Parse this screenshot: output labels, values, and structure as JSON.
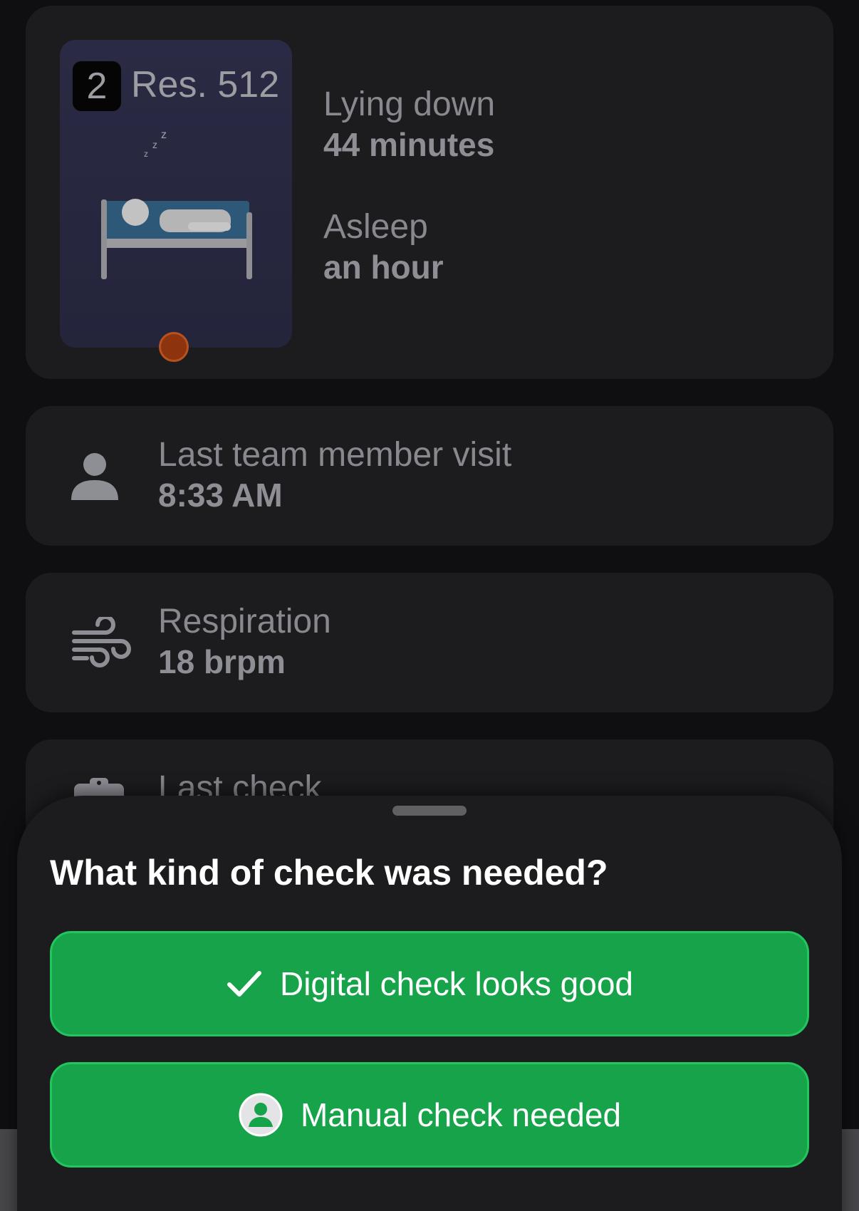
{
  "resident_card": {
    "room_number": "2",
    "room_label": "Res. 512",
    "bed_icon": "sleeping-person-in-bed-icon",
    "status_dot_color": "#8d330e",
    "lying": {
      "label": "Lying down",
      "value": "44 minutes"
    },
    "asleep": {
      "label": "Asleep",
      "value": "an hour"
    }
  },
  "visit_card": {
    "icon": "person-icon",
    "label": "Last team member visit",
    "value": "8:33 AM"
  },
  "respiration_card": {
    "icon": "wind-icon",
    "label": "Respiration",
    "value": "18 brpm"
  },
  "check_card": {
    "icon": "clipboard-icon",
    "label": "Last check"
  },
  "sheet": {
    "title": "What kind of check was needed?",
    "buttons": [
      {
        "label": "Digital check looks good",
        "icon": "check-icon"
      },
      {
        "label": "Manual check needed",
        "icon": "user-circle-icon"
      }
    ]
  },
  "colors": {
    "accent_green": "#16a34a",
    "card_background": "#1c1c1f",
    "page_background": "#0f0f11"
  }
}
